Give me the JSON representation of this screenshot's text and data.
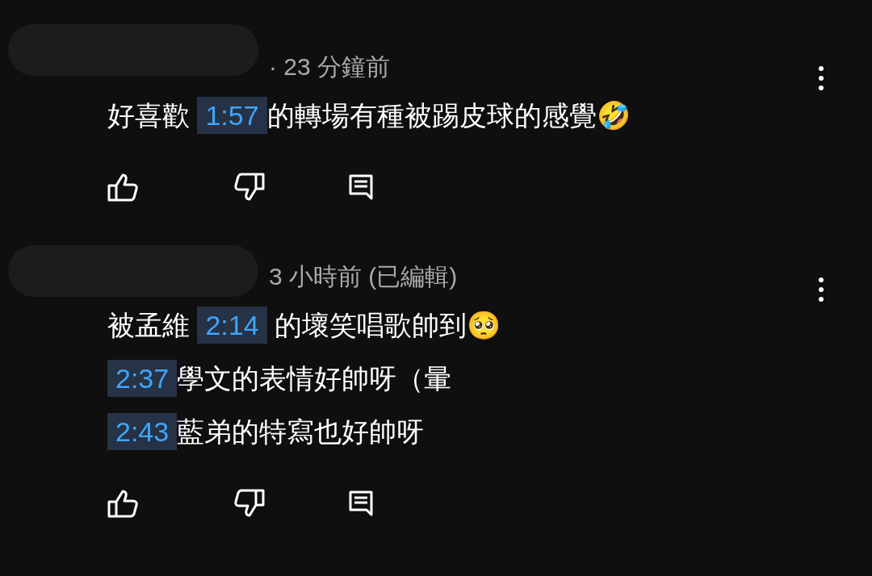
{
  "comments": [
    {
      "meta": "· 23 分鐘前",
      "lines": [
        [
          {
            "kind": "text",
            "text": "好喜歡 "
          },
          {
            "kind": "timestamp",
            "text": "1:57"
          },
          {
            "kind": "text",
            "text": "的轉場有種被踢皮球的感覺🤣"
          }
        ]
      ]
    },
    {
      "meta": "3 小時前 (已編輯)",
      "lines": [
        [
          {
            "kind": "text",
            "text": "被孟維 "
          },
          {
            "kind": "timestamp",
            "text": "2:14"
          },
          {
            "kind": "text",
            "text": " 的壞笑唱歌帥到🥺"
          }
        ],
        [
          {
            "kind": "timestamp",
            "text": "2:37"
          },
          {
            "kind": "text",
            "text": "學文的表情好帥呀（暈"
          }
        ],
        [
          {
            "kind": "timestamp",
            "text": "2:43"
          },
          {
            "kind": "text",
            "text": "藍弟的特寫也好帥呀"
          }
        ]
      ]
    }
  ]
}
